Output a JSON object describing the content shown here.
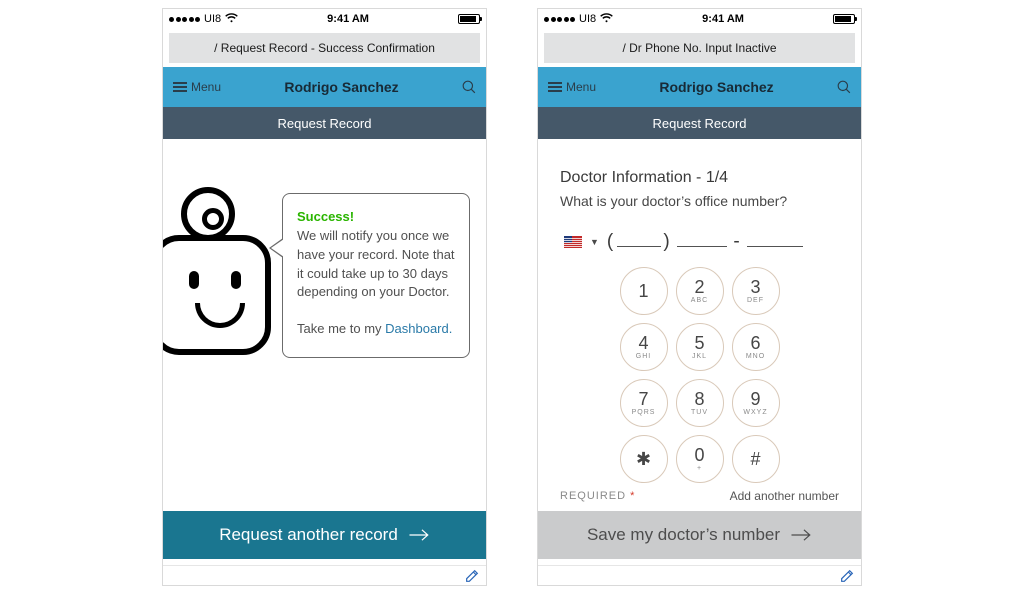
{
  "status_bar": {
    "carrier": "UI8",
    "time": "9:41 AM"
  },
  "screens": [
    {
      "breadcrumb": "/ Request Record - Success Confirmation",
      "header": {
        "menu_label": "Menu",
        "title": "Rodrigo Sanchez"
      },
      "sub_header": "Request Record",
      "bubble": {
        "success_label": "Success!",
        "body": "We will notify you once we have your record. Note that it could take up to 30 days depending on your Doctor.",
        "take_me_prefix": "Take me to my ",
        "dashboard_link": "Dashboard."
      },
      "cta_label": "Request another record"
    },
    {
      "breadcrumb": "/ Dr Phone No. Input Inactive",
      "header": {
        "menu_label": "Menu",
        "title": "Rodrigo Sanchez"
      },
      "sub_header": "Request Record",
      "form": {
        "title": "Doctor Information - 1/4",
        "question": "What is your doctor’s office number?"
      },
      "keypad": {
        "keys": [
          {
            "digit": "1",
            "letters": ""
          },
          {
            "digit": "2",
            "letters": "ABC"
          },
          {
            "digit": "3",
            "letters": "DEF"
          },
          {
            "digit": "4",
            "letters": "GHI"
          },
          {
            "digit": "5",
            "letters": "JKL"
          },
          {
            "digit": "6",
            "letters": "MNO"
          },
          {
            "digit": "7",
            "letters": "PQRS"
          },
          {
            "digit": "8",
            "letters": "TUV"
          },
          {
            "digit": "9",
            "letters": "WXYZ"
          },
          {
            "digit": "✱",
            "letters": ""
          },
          {
            "digit": "0",
            "letters": "+"
          },
          {
            "digit": "#",
            "letters": ""
          }
        ]
      },
      "required_label": "REQUIRED",
      "add_another_label": "Add another number",
      "cta_label": "Save my doctor’s number"
    }
  ],
  "colors": {
    "header_blue": "#3aa3cf",
    "sub_header": "#455869",
    "cta_teal": "#1a7690",
    "cta_gray": "#cacbcc",
    "success_green": "#2ab500",
    "link_blue": "#2a7aa8"
  }
}
